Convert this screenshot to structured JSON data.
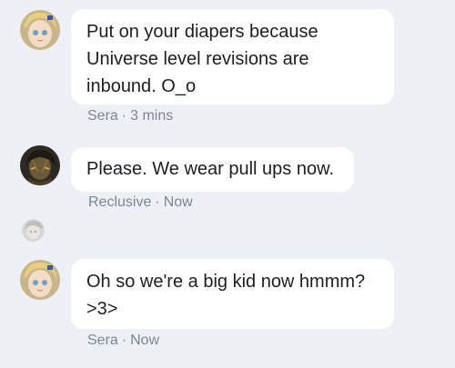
{
  "messages": [
    {
      "avatar": "sera-avatar",
      "text": "Put on your diapers because Universe level revisions are inbound. O_o",
      "author": "Sera",
      "time": "3 mins"
    },
    {
      "avatar": "reclusive-avatar",
      "text": "Please. We wear pull ups now.",
      "author": "Reclusive",
      "time": "Now"
    },
    {
      "avatar": "sera-avatar",
      "text": "Oh so we're a big kid now hmmm? >3>",
      "author": "Sera",
      "time": "Now"
    }
  ],
  "separator": "·",
  "colors": {
    "background": "#edf1f5",
    "bubble": "#ffffff",
    "meta_text": "#7b8694"
  }
}
